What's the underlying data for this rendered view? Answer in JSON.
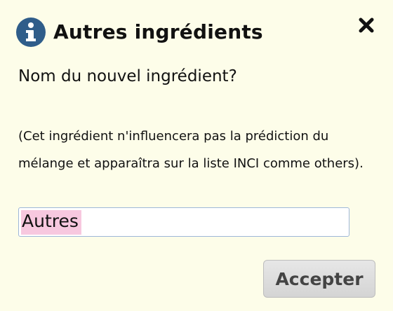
{
  "dialog": {
    "title": "Autres ingrédients",
    "question": "Nom du nouvel ingrédient?",
    "note": "(Cet ingrédient n'influencera pas la prédiction du mélange et apparaîtra sur la liste INCI comme others).",
    "input": {
      "value": "Autres",
      "selected_text": "Autres"
    },
    "accept_label": "Accepter"
  },
  "icons": {
    "title_icon": "info-icon",
    "close_icon": "close-icon"
  },
  "colors": {
    "background": "#fdfde9",
    "info_icon": "#2f5d8a",
    "selection": "#f7c8df",
    "input_border": "#9eb7d8",
    "button_background": "#dddddd",
    "button_text": "#444444"
  }
}
